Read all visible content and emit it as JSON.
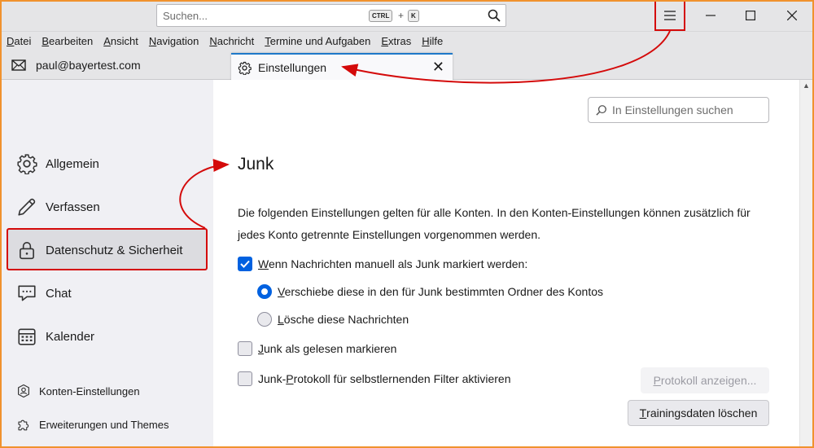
{
  "titlebar": {
    "search_placeholder": "Suchen...",
    "kbd_ctrl": "CTRL",
    "kbd_plus": "+",
    "kbd_k": "K"
  },
  "menubar": {
    "items": [
      {
        "u": "D",
        "rest": "atei"
      },
      {
        "u": "B",
        "rest": "earbeiten"
      },
      {
        "u": "A",
        "rest": "nsicht"
      },
      {
        "u": "N",
        "rest": "avigation"
      },
      {
        "u": "N",
        "rest": "achricht"
      },
      {
        "u": "T",
        "rest": "ermine und Aufgaben"
      },
      {
        "u": "E",
        "rest": "xtras"
      },
      {
        "u": "H",
        "rest": "ilfe"
      }
    ]
  },
  "tabs": {
    "account": "paul@bayertest.com",
    "active": "Einstellungen",
    "close": "✕"
  },
  "sidebar": {
    "categories": [
      {
        "label": "Allgemein",
        "icon": "gear-icon"
      },
      {
        "label": "Verfassen",
        "icon": "pencil-icon"
      },
      {
        "label": "Datenschutz & Sicherheit",
        "icon": "lock-icon",
        "selected": true
      },
      {
        "label": "Chat",
        "icon": "chat-icon"
      },
      {
        "label": "Kalender",
        "icon": "calendar-icon"
      }
    ],
    "bottom": [
      {
        "label": "Konten-Einstellungen",
        "icon": "account-icon"
      },
      {
        "label": "Erweiterungen und Themes",
        "icon": "puzzle-icon"
      }
    ]
  },
  "main": {
    "search_placeholder": "In Einstellungen suchen",
    "heading": "Junk",
    "description": "Die folgenden Einstellungen gelten für alle Konten. In den Konten-Einstellungen können zusätzlich für jedes Konto getrennte Einstellungen vorgenommen werden.",
    "opt_manual": {
      "u": "W",
      "rest": "enn Nachrichten manuell als Junk markiert werden:",
      "checked": true
    },
    "radio_move": {
      "u": "V",
      "rest": "erschiebe diese in den für Junk bestimmten Ordner des Kontos",
      "selected": true
    },
    "radio_delete": {
      "u": "L",
      "rest": "ösche diese Nachrichten",
      "selected": false
    },
    "opt_read": {
      "u": "J",
      "rest": "unk als gelesen markieren",
      "checked": false
    },
    "opt_log": {
      "pre": "Junk-",
      "u": "P",
      "rest": "rotokoll für selbstlernenden Filter aktivieren",
      "checked": false
    },
    "btn_log": {
      "u": "P",
      "rest": "rotokoll anzeigen..."
    },
    "btn_train": {
      "u": "T",
      "rest": "rainingsdaten löschen"
    }
  },
  "colors": {
    "accent": "#0061e0",
    "annotation": "#d40a0a",
    "frame": "#f0922e",
    "tab_indicator": "#1e79c9"
  }
}
